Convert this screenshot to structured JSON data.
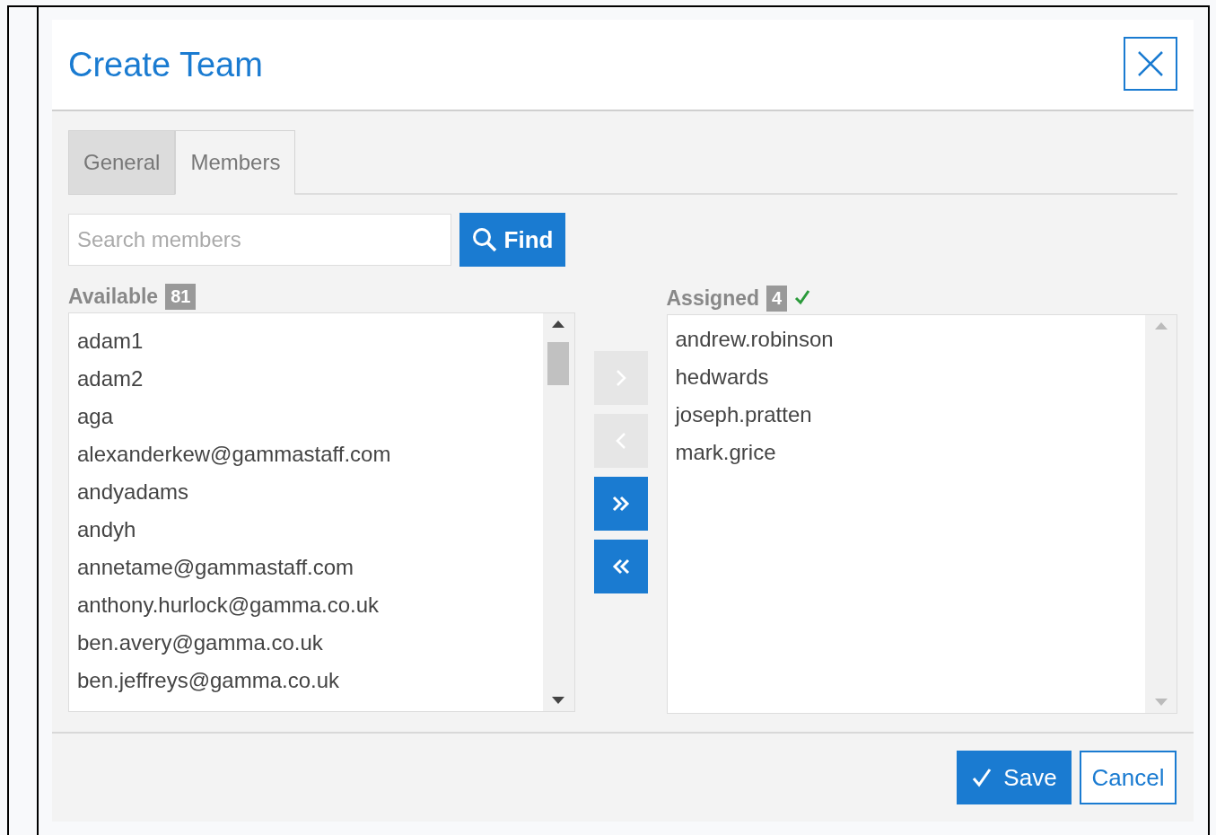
{
  "dialog": {
    "title": "Create Team"
  },
  "tabs": [
    {
      "label": "General",
      "selected": false
    },
    {
      "label": "Members",
      "selected": true
    }
  ],
  "search": {
    "placeholder": "Search members",
    "button": "Find"
  },
  "available": {
    "label": "Available",
    "count": "81",
    "items": [
      "adam1",
      "adam2",
      "aga",
      "alexanderkew@gammastaff.com",
      "andyadams",
      "andyh",
      "annetame@gammastaff.com",
      "anthony.hurlock@gamma.co.uk",
      "ben.avery@gamma.co.uk",
      "ben.jeffreys@gamma.co.uk"
    ]
  },
  "transfer_buttons": [
    {
      "kind": "move-right",
      "disabled": true
    },
    {
      "kind": "move-left",
      "disabled": true
    },
    {
      "kind": "move-all-right",
      "disabled": false
    },
    {
      "kind": "move-all-left",
      "disabled": false
    }
  ],
  "assigned": {
    "label": "Assigned",
    "count": "4",
    "valid": true,
    "items": [
      "andrew.robinson",
      "hedwards",
      "joseph.pratten",
      "mark.grice"
    ]
  },
  "footer": {
    "save": "Save",
    "cancel": "Cancel"
  }
}
